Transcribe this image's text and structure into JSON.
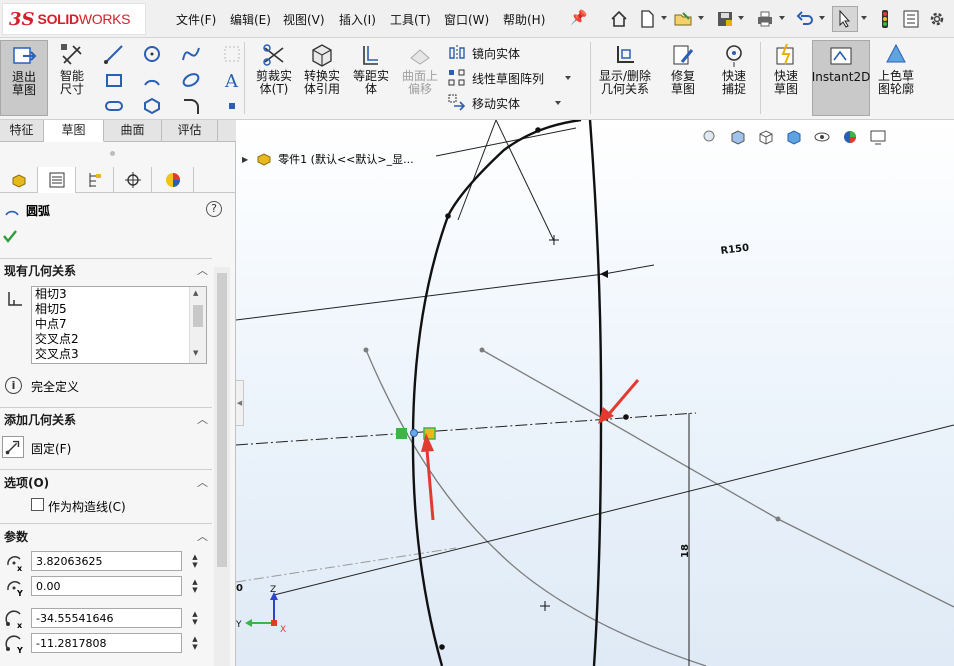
{
  "app": {
    "logo_prefix": "3S",
    "logo_brand": "SOLID",
    "logo_brand2": "WORKS"
  },
  "menu": {
    "file": "文件(F)",
    "edit": "编辑(E)",
    "view": "视图(V)",
    "insert": "插入(I)",
    "tools": "工具(T)",
    "window": "窗口(W)",
    "help": "帮助(H)"
  },
  "ribbon": {
    "exit_sketch": "退出草图",
    "smart_dim": "智能尺寸",
    "trim": "剪裁实体(T)",
    "convert": "转换实体引用",
    "offset": "等距实体",
    "surface_offset": "曲面上偏移",
    "mirror": "镜向实体",
    "linear_pattern": "线性草图阵列",
    "move": "移动实体",
    "show_delete_relations": "显示/删除几何关系",
    "repair_sketch": "修复草图",
    "quick_snap": "快速捕捉",
    "rapid_sketch": "快速草图",
    "instant2d": "Instant2D",
    "shaded_contours": "上色草图轮廓"
  },
  "tabs": [
    "特征",
    "草图",
    "曲面",
    "评估"
  ],
  "active_tab": "草图",
  "property_manager": {
    "title": "圆弧",
    "existing_relations_header": "现有几何关系",
    "relations": [
      "相切3",
      "相切5",
      "中点7",
      "交叉点2",
      "交叉点3"
    ],
    "status": "完全定义",
    "add_relations_header": "添加几何关系",
    "fix_label": "固定(F)",
    "options_header": "选项(O)",
    "construction_label": "作为构造线(C)",
    "construction_checked": false,
    "parameters_header": "参数",
    "params": {
      "cx": "3.82063625",
      "cy": "0.00",
      "sx": "-34.55541646",
      "sy": "-11.2817808"
    }
  },
  "viewport": {
    "tree_item": "零件1 (默认<<默认>_显...",
    "dim_radius": "R150",
    "dim_vertical": "18",
    "dim_partial": "0",
    "triad_x": "X",
    "triad_y": "Y",
    "triad_z": "Z"
  },
  "colors": {
    "accent_red": "#e33a2f",
    "relation_green": "#39b54a",
    "active_btn": "#c9c9c9"
  }
}
